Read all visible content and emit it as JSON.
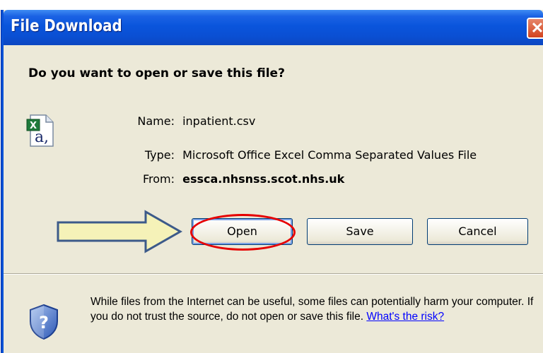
{
  "window": {
    "title": "File Download",
    "close_glyph": "✕"
  },
  "prompt": {
    "question": "Do you want to open or save this file?"
  },
  "file": {
    "icon": "excel-csv-file-icon",
    "name_label": "Name:",
    "name_value": "inpatient.csv",
    "type_label": "Type:",
    "type_value": "Microsoft Office Excel Comma Separated Values File",
    "from_label": "From:",
    "from_value": "essca.nhsnss.scot.nhs.uk"
  },
  "buttons": {
    "open_label": "Open",
    "save_label": "Save",
    "cancel_label": "Cancel"
  },
  "annotations": {
    "arrow_color": "#f5f2b8",
    "arrow_border": "#3c5a8a",
    "highlight_color": "#e60000"
  },
  "warning": {
    "icon": "security-shield-question-icon",
    "text": "While files from the Internet can be useful, some files can potentially harm your computer. If you do not trust the source, do not open or save this file. ",
    "link_text": "What's the risk?"
  }
}
